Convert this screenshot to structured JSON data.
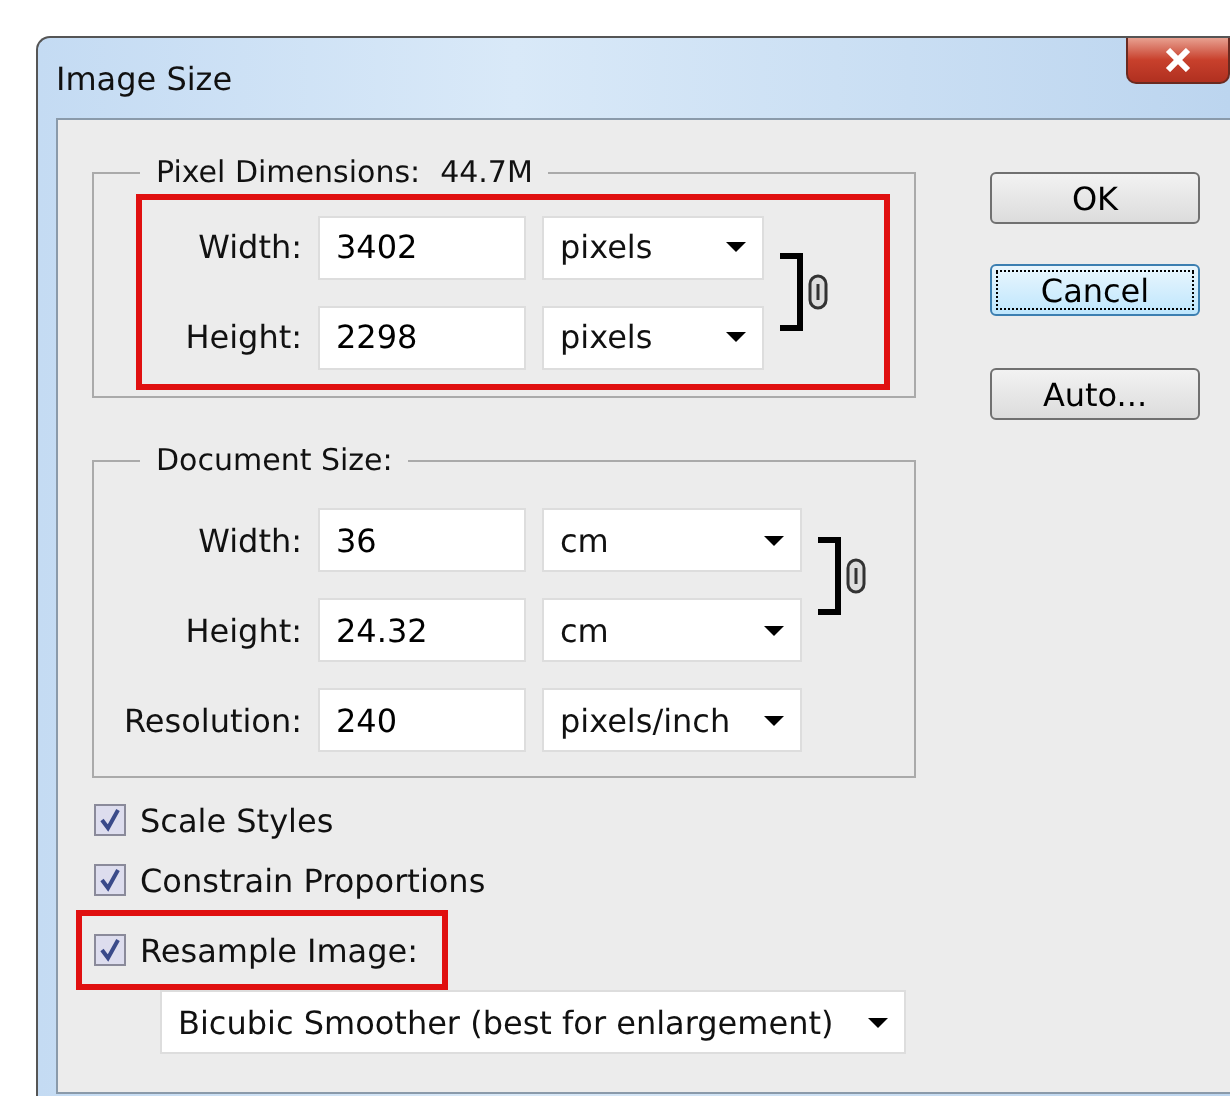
{
  "window": {
    "title": "Image Size"
  },
  "pixel_dimensions": {
    "label": "Pixel Dimensions:",
    "value": "44.7M",
    "highlighted": true,
    "linked": true,
    "fields": [
      {
        "label": "Width:",
        "value": "3402",
        "unit": "pixels"
      },
      {
        "label": "Height:",
        "value": "2298",
        "unit": "pixels"
      }
    ]
  },
  "document_size": {
    "label": "Document Size:",
    "linked": true,
    "fields": [
      {
        "label": "Width:",
        "value": "36",
        "unit": "cm"
      },
      {
        "label": "Height:",
        "value": "24.32",
        "unit": "cm"
      },
      {
        "label": "Resolution:",
        "value": "240",
        "unit": "pixels/inch"
      }
    ]
  },
  "options": [
    {
      "label": "Scale Styles",
      "checked": true,
      "highlighted": false
    },
    {
      "label": "Constrain Proportions",
      "checked": true,
      "highlighted": false
    },
    {
      "label": "Resample Image:",
      "checked": true,
      "highlighted": true
    }
  ],
  "resample_method": "Bicubic Smoother (best for enlargement)",
  "buttons": [
    {
      "label": "OK",
      "focused": false
    },
    {
      "label": "Cancel",
      "focused": true
    },
    {
      "label": "Auto...",
      "focused": false
    }
  ]
}
